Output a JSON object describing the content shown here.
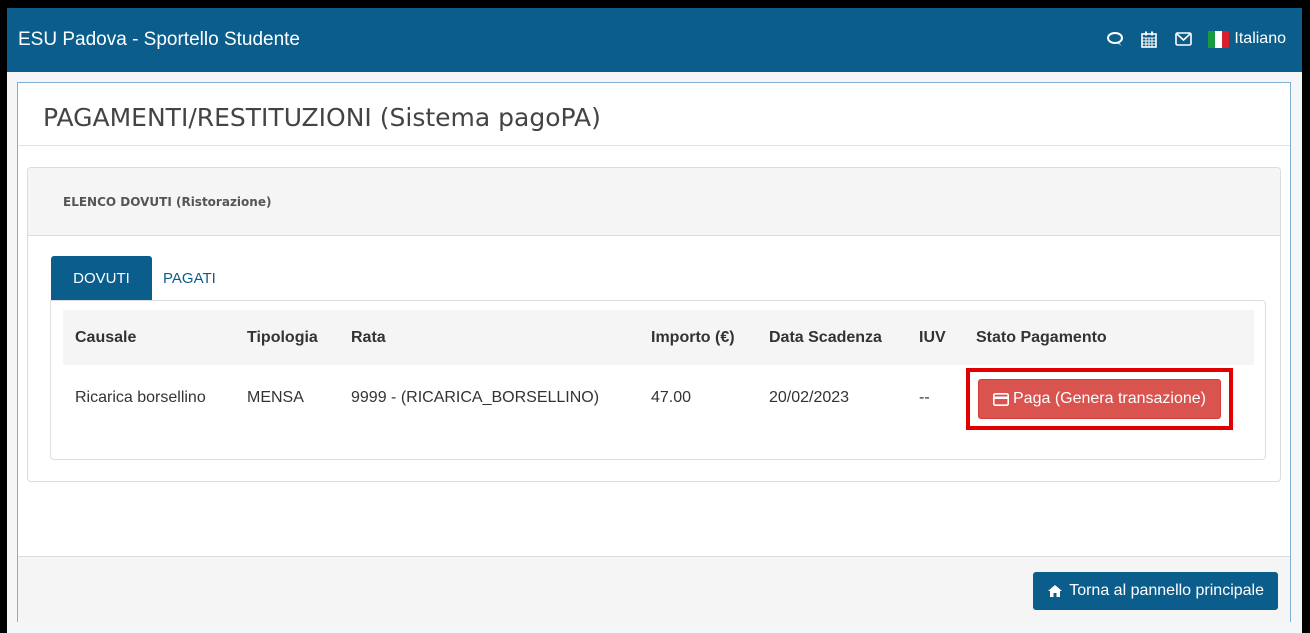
{
  "navbar": {
    "brand": "ESU Padova - Sportello Studente",
    "icons": [
      "chat-icon",
      "calendar-icon",
      "mail-icon"
    ],
    "language": "Italiano"
  },
  "page": {
    "title": "PAGAMENTI/RESTITUZIONI (Sistema pagoPA)"
  },
  "section": {
    "title": "ELENCO DOVUTI (Ristorazione)",
    "tabs": [
      {
        "label": "DOVUTI",
        "active": true
      },
      {
        "label": "PAGATI",
        "active": false
      }
    ]
  },
  "table": {
    "headers": [
      "Causale",
      "Tipologia",
      "Rata",
      "Importo (€)",
      "Data Scadenza",
      "IUV",
      "Stato Pagamento"
    ],
    "rows": [
      {
        "causale": "Ricarica borsellino",
        "tipologia": "MENSA",
        "rata": "9999 - (RICARICA_BORSELLINO)",
        "importo": "47.00",
        "scadenza": "20/02/2023",
        "iuv": "--",
        "action_label": "Paga (Genera transazione)"
      }
    ]
  },
  "footer": {
    "home_button": "Torna al pannello principale"
  },
  "colors": {
    "primary": "#0b5d8c",
    "danger": "#d9534f",
    "highlight": "#e00000"
  }
}
